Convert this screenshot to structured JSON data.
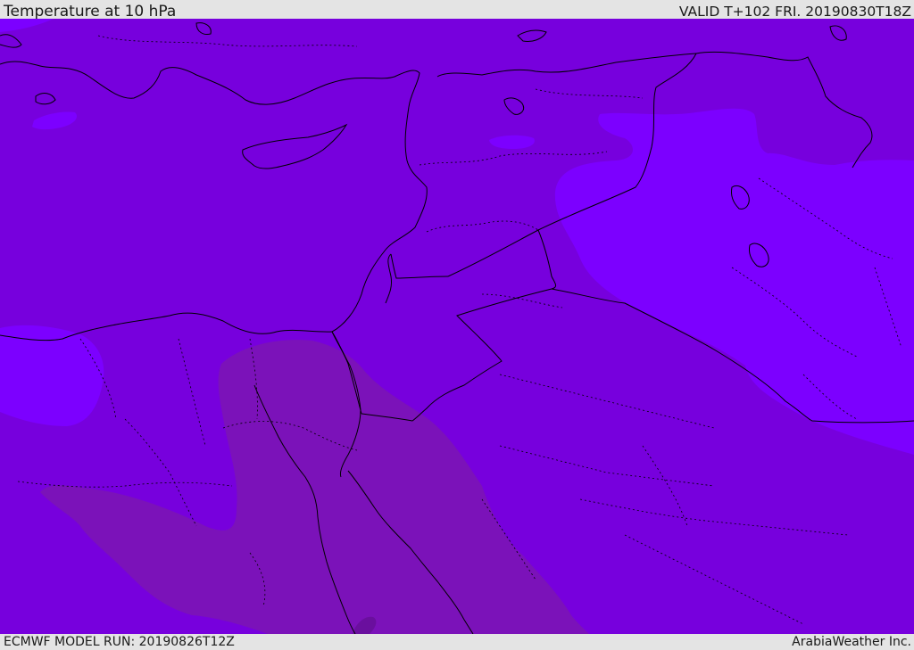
{
  "header": {
    "title": "Temperature at 10 hPa",
    "valid": "VALID T+102 FRI. 20190830T18Z"
  },
  "footer": {
    "model_run": "ECMWF MODEL RUN: 20190826T12Z",
    "credit": "ArabiaWeather Inc."
  },
  "colors": {
    "band_base": "#7700dd",
    "band_cooler": "#7c00ff",
    "band_warmer": "#7b12b9",
    "band_warmest": "#6a0f9e",
    "border_line": "#000000",
    "bar_background": "#e4e4e4"
  }
}
